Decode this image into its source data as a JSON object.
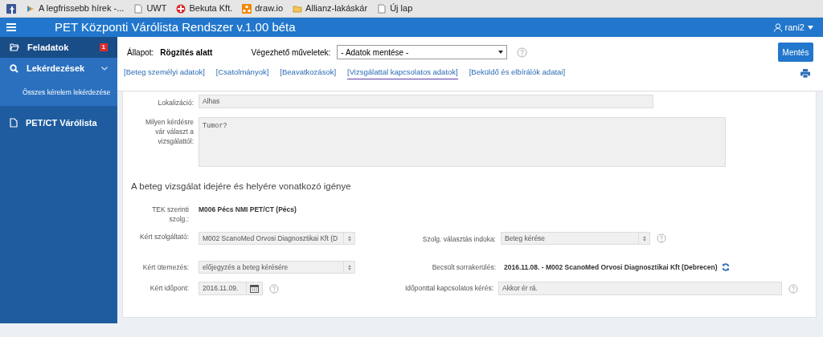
{
  "bookmarks": [
    {
      "kind": "facebook"
    },
    {
      "kind": "news",
      "label": "A legfrissebb hírek -..."
    },
    {
      "kind": "page",
      "label": "UWT"
    },
    {
      "kind": "cross",
      "label": "Bekuta Kft."
    },
    {
      "kind": "drawio",
      "label": "draw.io"
    },
    {
      "kind": "folder",
      "label": "Allianz-lakáskár"
    },
    {
      "kind": "page",
      "label": "Új lap"
    }
  ],
  "header": {
    "title": "PET Központi Várólista Rendszer v.1.00 béta",
    "user": "rani2"
  },
  "sidebar": {
    "items": [
      {
        "kind": "folder",
        "label": "Feladatok",
        "badge": "1",
        "selected": true
      },
      {
        "kind": "search",
        "label": "Lekérdezések",
        "selected": false,
        "expanded": true,
        "children": [
          {
            "label": "Összes kérelem lekérdezése",
            "selected": false
          }
        ]
      },
      {
        "kind": "file",
        "label": "PET/CT Várólista",
        "selected": false
      }
    ]
  },
  "toolbar": {
    "status_label": "Állapot:",
    "status_value": "Rögzítés alatt",
    "actions_label": "Végezhető műveletek:",
    "actions_value": "- Adatok mentése -",
    "save_button": "Mentés",
    "tabs": [
      {
        "label": "[Beteg személyi adatok]",
        "selected": false
      },
      {
        "label": "[Csatolmányok]",
        "selected": false
      },
      {
        "label": "[Beavatkozások]",
        "selected": false
      },
      {
        "label": "[Vizsgálattal kapcsolatos adatok]",
        "selected": true
      },
      {
        "label": "[Beküldő és elbírálók adatai]",
        "selected": false
      }
    ]
  },
  "form": {
    "localization": {
      "label": "Lokalizáció:",
      "value": "Alhas"
    },
    "question": {
      "label": "Milyen kérdésre vár választ a vizsgálattól:",
      "value": "Tumor?"
    },
    "section_title": "A beteg vizsgálat idejére és helyére vonatkozó igénye",
    "tek": {
      "label": "TEK szerinti szolg.:",
      "value": "M006 Pécs NMI PET/CT (Pécs)"
    },
    "provider": {
      "label": "Kért szolgáltató:",
      "value": "M002 ScanoMed Orvosi Diagnosztikai Kft (D"
    },
    "reason": {
      "label": "Szolg. választás indoka:",
      "value": "Beteg kérése"
    },
    "schedule": {
      "label": "Kért ütemezés:",
      "value": "előjegyzés a beteg kérésére"
    },
    "estimate": {
      "label": "Becsült sorrakerülés:",
      "value": "2016.11.08. - M002 ScanoMed Orvosi Diagnosztikai Kft (Debrecen)"
    },
    "date": {
      "label": "Kért időpont:",
      "value": "2016.11.09."
    },
    "date_request": {
      "label": "Időponttal kapcsolatos kérés:",
      "value": "Akkor ér rá."
    }
  }
}
